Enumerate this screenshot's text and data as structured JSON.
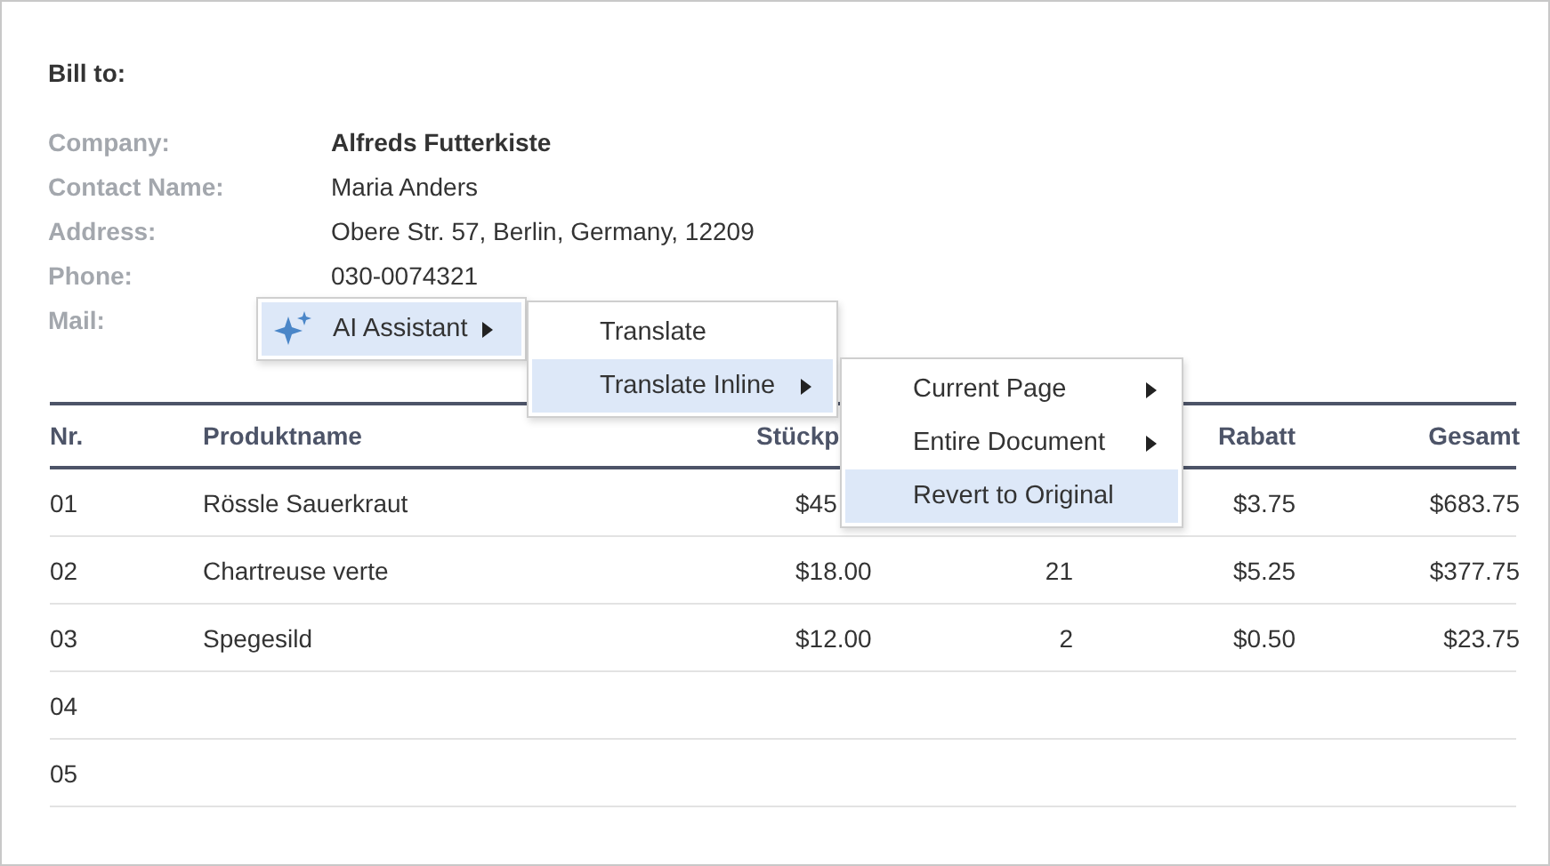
{
  "bill_to": {
    "heading": "Bill to:",
    "fields": [
      {
        "label": "Company:",
        "value": "Alfreds Futterkiste",
        "emphasis": true
      },
      {
        "label": "Contact Name:",
        "value": "Maria Anders",
        "emphasis": false
      },
      {
        "label": "Address:",
        "value": "Obere Str. 57, Berlin, Germany, 12209",
        "emphasis": false
      },
      {
        "label": "Phone:",
        "value": "030-0074321",
        "emphasis": false
      },
      {
        "label": "Mail:"
      }
    ]
  },
  "table": {
    "columns": [
      {
        "label": "Nr."
      },
      {
        "label": "Produktname"
      },
      {
        "label": "Stückp"
      },
      {},
      {
        "label": "Rabatt"
      },
      {
        "label": "Gesamt"
      }
    ],
    "rows": [
      [
        "01",
        "Rössle Sauerkraut",
        "$45",
        null,
        "$3.75",
        "$683.75"
      ],
      [
        "02",
        "Chartreuse verte",
        "$18.00",
        "21",
        "$5.25",
        "$377.75"
      ],
      [
        "03",
        "Spegesild",
        "$12.00",
        "2",
        "$0.50",
        "$23.75"
      ],
      [
        "04"
      ],
      [
        "05"
      ]
    ]
  },
  "menus": [
    {
      "items": [
        {
          "label": "AI Assistant",
          "icon": true,
          "has_submenu": true,
          "selected": true
        }
      ]
    },
    {
      "items": [
        {
          "label": "Translate",
          "has_submenu": false,
          "selected": false
        },
        {
          "label": "Translate Inline",
          "has_submenu": true,
          "selected": true
        }
      ]
    },
    {
      "items": [
        {
          "label": "Current Page",
          "has_submenu": true,
          "selected": false
        },
        {
          "label": "Entire Document",
          "has_submenu": true,
          "selected": false
        },
        {
          "label": "Revert to Original",
          "has_submenu": false,
          "selected": true
        }
      ]
    }
  ]
}
